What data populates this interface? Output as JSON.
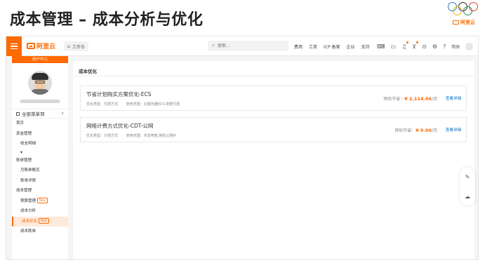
{
  "slide": {
    "title": "成本管理 – 成本分析与优化"
  },
  "brand": {
    "logo_text": "阿里云"
  },
  "topbar": {
    "logo_text": "阿里云",
    "workbench": "工作台",
    "search_placeholder": "搜索...",
    "links": [
      "费用",
      "工单",
      "ICP 备案",
      "企业",
      "支持"
    ],
    "lang": "简体"
  },
  "sidebar": {
    "user_center": "用户中心",
    "all_menu": "全部菜单项",
    "items": [
      {
        "label": "首页"
      },
      {
        "label": "资金管理"
      },
      {
        "label": "收支明细"
      },
      {
        "label": "账单管理"
      },
      {
        "label": "月账单概览"
      },
      {
        "label": "账单详情"
      },
      {
        "label": "成本管理"
      },
      {
        "label": "预算管理",
        "badge": "New"
      },
      {
        "label": "成本分析"
      },
      {
        "label": "成本优化",
        "badge": "New"
      },
      {
        "label": "成本账单"
      }
    ]
  },
  "main": {
    "title": "成本优化",
    "cards": [
      {
        "title": "节省计划购买方案优化-ECS",
        "type_label": "优化类型：付费方式",
        "scope_label": "使用范围：云服务器ECS-按量付费",
        "savings_label": "预估节省：",
        "savings_amount": "¥ 2,114.96",
        "unit": "/月",
        "detail": "查看详细"
      },
      {
        "title": "网络计费方式优化-CDT-公网",
        "type_label": "优化类型：计费方式",
        "scope_label": "使用范围：共享带宽,弹性公网IP",
        "savings_label": "预估节省：",
        "savings_amount": "¥ 0.00",
        "unit": "/月",
        "detail": "查看详细"
      }
    ]
  }
}
